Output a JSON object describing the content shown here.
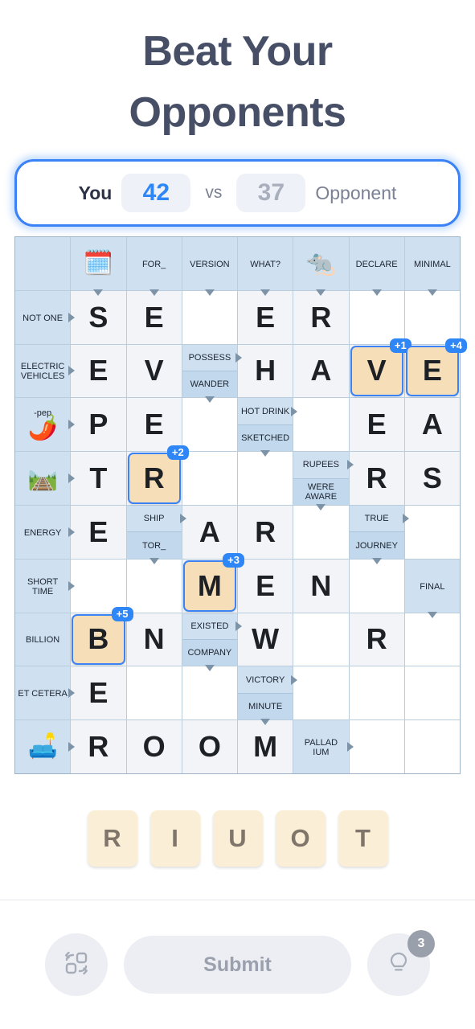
{
  "headline": {
    "line1": "Beat Your",
    "line2": "Opponents"
  },
  "scorebar": {
    "you_label": "You",
    "you_score": "42",
    "vs": "vs",
    "opponent_score": "37",
    "opponent_label": "Opponent",
    "you_color": "#2f86f6",
    "opponent_color": "#a9afbd",
    "border_color": "#3b82f6"
  },
  "grid": {
    "rows": 10,
    "cols": 8,
    "cells": [
      [
        {
          "type": "empty-blue"
        },
        {
          "type": "clue",
          "text": "",
          "emoji": "🗓️",
          "down": true
        },
        {
          "type": "clue",
          "text": "FOR_",
          "down": true
        },
        {
          "type": "clue",
          "text": "VERSION",
          "down": true
        },
        {
          "type": "clue",
          "text": "WHAT?",
          "down": true
        },
        {
          "type": "clue",
          "text": "",
          "emoji": "🐀",
          "down": true
        },
        {
          "type": "clue",
          "text": "DECLARE",
          "down": true
        },
        {
          "type": "clue",
          "text": "MINIMAL",
          "down": true
        }
      ],
      [
        {
          "type": "clue",
          "text": "NOT ONE",
          "right": true
        },
        {
          "type": "letter",
          "letter": "S"
        },
        {
          "type": "letter",
          "letter": "E"
        },
        {
          "type": "blank"
        },
        {
          "type": "letter",
          "letter": "E"
        },
        {
          "type": "letter",
          "letter": "R"
        },
        {
          "type": "blank"
        },
        {
          "type": "blank"
        }
      ],
      [
        {
          "type": "clue",
          "text": "ELECTRIC VEHICLES",
          "right": true
        },
        {
          "type": "letter",
          "letter": "E"
        },
        {
          "type": "letter",
          "letter": "V"
        },
        {
          "type": "split",
          "top": "POSSESS",
          "bottom": "WANDER",
          "right": true,
          "down": true
        },
        {
          "type": "letter",
          "letter": "H"
        },
        {
          "type": "letter",
          "letter": "A"
        },
        {
          "type": "letter",
          "letter": "V",
          "placed": true,
          "badge": "+1"
        },
        {
          "type": "letter",
          "letter": "E",
          "placed": true,
          "badge": "+4"
        }
      ],
      [
        {
          "type": "clue",
          "text": "-pep",
          "emoji": "🌶️",
          "right": true
        },
        {
          "type": "letter",
          "letter": "P"
        },
        {
          "type": "letter",
          "letter": "E"
        },
        {
          "type": "blank"
        },
        {
          "type": "split",
          "top": "HOT DRINK",
          "bottom": "SKETCHED",
          "right": true,
          "down": true
        },
        {
          "type": "blank"
        },
        {
          "type": "letter",
          "letter": "E"
        },
        {
          "type": "letter",
          "letter": "A"
        }
      ],
      [
        {
          "type": "clue",
          "text": "",
          "emoji": "🛤️",
          "right": true
        },
        {
          "type": "letter",
          "letter": "T"
        },
        {
          "type": "letter",
          "letter": "R",
          "placed": true,
          "badge": "+2"
        },
        {
          "type": "blank"
        },
        {
          "type": "blank"
        },
        {
          "type": "split",
          "top": "RUPEES",
          "bottom": "WERE AWARE",
          "right": true,
          "down": true
        },
        {
          "type": "letter",
          "letter": "R"
        },
        {
          "type": "letter",
          "letter": "S"
        }
      ],
      [
        {
          "type": "clue",
          "text": "ENERGY",
          "right": true
        },
        {
          "type": "letter",
          "letter": "E"
        },
        {
          "type": "split",
          "top": "SHIP",
          "bottom": "TOR_",
          "right": true,
          "down": true
        },
        {
          "type": "letter",
          "letter": "A"
        },
        {
          "type": "letter",
          "letter": "R"
        },
        {
          "type": "blank"
        },
        {
          "type": "split",
          "top": "TRUE",
          "bottom": "JOURNEY",
          "right": true,
          "down": true
        },
        {
          "type": "blank"
        }
      ],
      [
        {
          "type": "clue",
          "text": "SHORT TIME",
          "right": true
        },
        {
          "type": "blank"
        },
        {
          "type": "blank"
        },
        {
          "type": "letter",
          "letter": "M",
          "placed": true,
          "badge": "+3"
        },
        {
          "type": "letter",
          "letter": "E"
        },
        {
          "type": "letter",
          "letter": "N"
        },
        {
          "type": "blank"
        },
        {
          "type": "clue",
          "text": "FINAL",
          "down": true
        }
      ],
      [
        {
          "type": "clue",
          "text": "BILLION"
        },
        {
          "type": "letter",
          "letter": "B",
          "placed": true,
          "badge": "+5"
        },
        {
          "type": "letter",
          "letter": "N"
        },
        {
          "type": "split",
          "top": "EXISTED",
          "bottom": "COMPANY",
          "right": true,
          "down": true
        },
        {
          "type": "letter",
          "letter": "W"
        },
        {
          "type": "blank"
        },
        {
          "type": "letter",
          "letter": "R"
        },
        {
          "type": "blank"
        }
      ],
      [
        {
          "type": "clue",
          "text": "ET CETERA",
          "right": true
        },
        {
          "type": "letter",
          "letter": "E"
        },
        {
          "type": "blank"
        },
        {
          "type": "blank"
        },
        {
          "type": "split",
          "top": "VICTORY",
          "bottom": "MINUTE",
          "right": true,
          "down": true
        },
        {
          "type": "blank"
        },
        {
          "type": "blank"
        },
        {
          "type": "blank"
        }
      ],
      [
        {
          "type": "clue",
          "text": "",
          "emoji": "🛋️",
          "right": true
        },
        {
          "type": "letter",
          "letter": "R"
        },
        {
          "type": "letter",
          "letter": "O"
        },
        {
          "type": "letter",
          "letter": "O"
        },
        {
          "type": "letter",
          "letter": "M"
        },
        {
          "type": "clue",
          "text": "PALLAD IUM",
          "right": true
        },
        {
          "type": "blank"
        },
        {
          "type": "blank"
        }
      ]
    ]
  },
  "rack": {
    "tiles": [
      "R",
      "I",
      "U",
      "O",
      "T"
    ]
  },
  "bottombar": {
    "shuffle_icon": "shuffle-icon",
    "submit_label": "Submit",
    "hint_icon": "lightbulb-icon",
    "hint_count": "3"
  }
}
